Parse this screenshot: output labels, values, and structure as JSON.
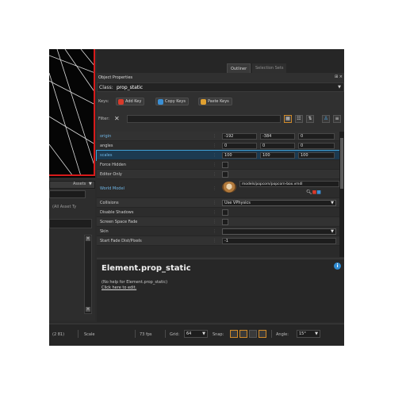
{
  "tabs": {
    "outliner": "Outliner",
    "selection_sets": "Selection Sets"
  },
  "left": {
    "assets_label": "Assets",
    "asset_type": "(All Asset Ty"
  },
  "object_properties": {
    "header": "Object Properties",
    "class_label": "Class:",
    "class_value": "prop_static",
    "keys_label": "Keys:",
    "add_key": "Add Key",
    "copy_keys": "Copy Keys",
    "paste_keys": "Paste Keys",
    "filter_label": "Filter:"
  },
  "properties": [
    {
      "name": "origin",
      "values": [
        "-192",
        "-384",
        "0"
      ]
    },
    {
      "name": "angles",
      "values": [
        "0",
        "0",
        "0"
      ]
    },
    {
      "name": "scales",
      "values": [
        "100",
        "100",
        "100"
      ]
    },
    {
      "name": "Force Hidden"
    },
    {
      "name": "Editor Only"
    },
    {
      "name": "World Model",
      "path": "models/popcorn/popcorn-box.vmdl"
    },
    {
      "name": "Collisions",
      "select": "Use VPhysics"
    },
    {
      "name": "Disable Shadows"
    },
    {
      "name": "Screen Space Fade"
    },
    {
      "name": "Skin",
      "select": ""
    },
    {
      "name": "Start Fade Dist/Pixels",
      "value": "-1"
    }
  ],
  "help": {
    "title": "Element.prop_static",
    "text": "(No help for Element.prop_static)",
    "link": "Click here to edit."
  },
  "status": {
    "coords": "(2 81)",
    "mode": "Scale",
    "fps": "73 fps",
    "grid_label": "Grid:",
    "grid_value": "64",
    "snap_label": "Snap:",
    "angle_label": "Angle:",
    "angle_value": "15°"
  }
}
